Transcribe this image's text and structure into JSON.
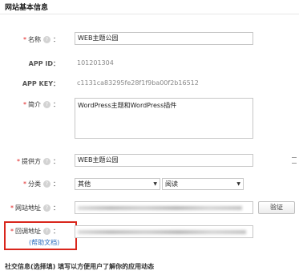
{
  "header": {
    "title": "网站基本信息"
  },
  "form": {
    "name": {
      "label": "名称",
      "value": "WEB主题公园"
    },
    "app_id": {
      "label": "APP ID：",
      "value": "101201304"
    },
    "app_key": {
      "label": "APP KEY：",
      "value": "c1131ca83295fe28f1f9ba00f2b16512"
    },
    "summary": {
      "label": "简介",
      "value": "WordPress主题和WordPress插件"
    },
    "provider": {
      "label": "提供方",
      "value": "WEB主题公园"
    },
    "category": {
      "label": "分类",
      "primary": "其他",
      "secondary": "阅读"
    },
    "website": {
      "label": "网站地址",
      "verify_label": "验证"
    },
    "callback": {
      "label": "回调地址",
      "help_link": "(帮助文档)"
    },
    "colon": "：",
    "required_mark": "*",
    "help_glyph": "?"
  },
  "footer": {
    "text": "社交信息(选择填)   填写以方便用户了解你的应用动态"
  },
  "colors": {
    "required": "#e02020",
    "highlight_box": "#d9261c",
    "link": "#2a6dbf"
  }
}
